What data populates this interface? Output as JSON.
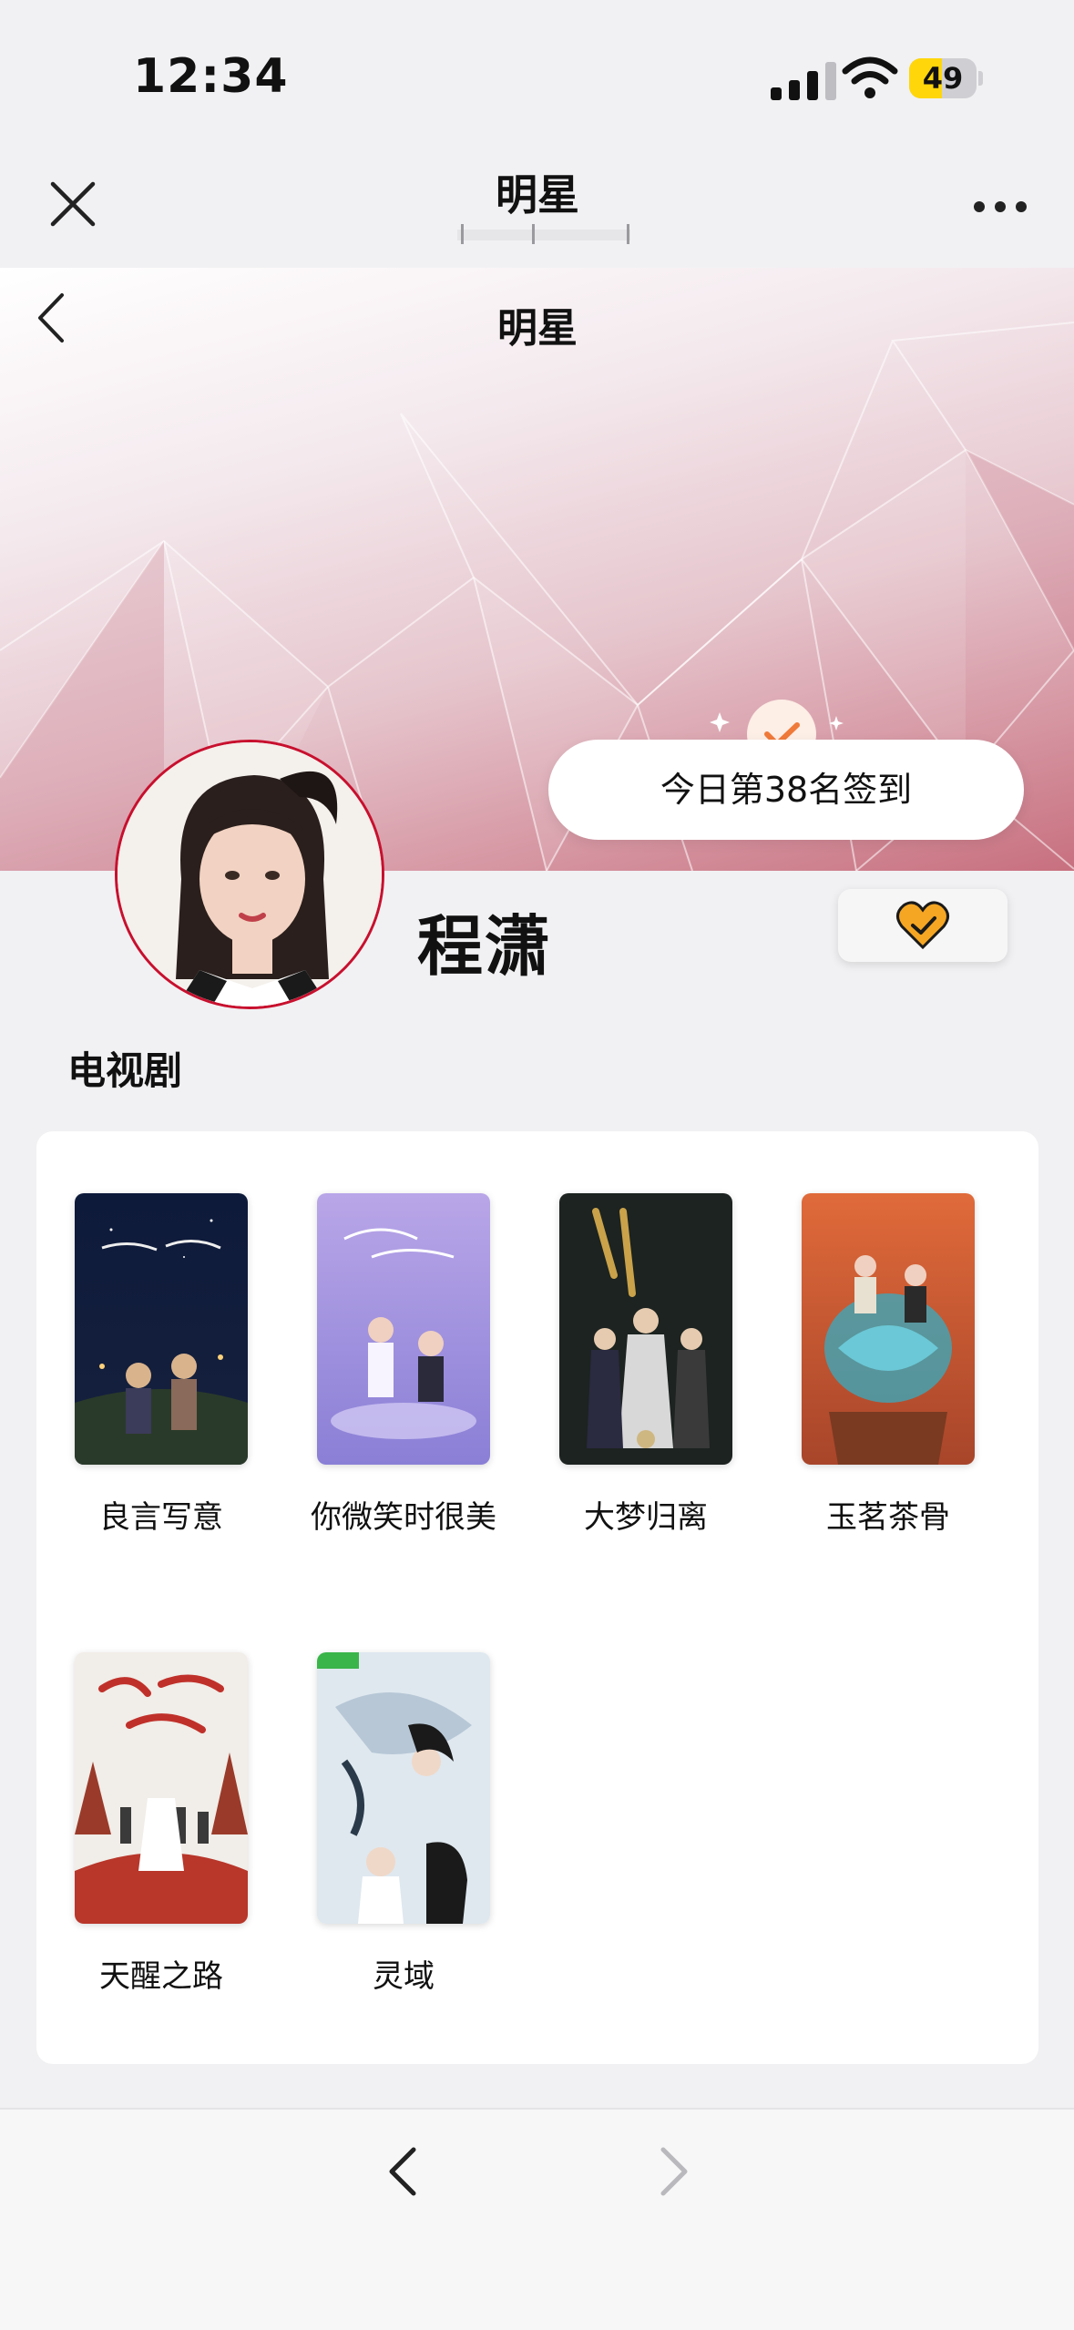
{
  "status_bar": {
    "time": "12:34",
    "battery_level": "49",
    "battery_fraction": 0.49
  },
  "nav": {
    "title": "明星"
  },
  "banner": {
    "title": "明星"
  },
  "checkin": {
    "text": "今日第38名签到"
  },
  "profile": {
    "name": "程潇"
  },
  "section": {
    "title": "电视剧"
  },
  "dramas": [
    {
      "title": "良言写意"
    },
    {
      "title": "你微笑时很美"
    },
    {
      "title": "大梦归离"
    },
    {
      "title": "玉茗茶骨"
    },
    {
      "title": "天醒之路"
    },
    {
      "title": "灵域"
    }
  ],
  "colors": {
    "accent": "#c8102e",
    "follow_heart": "#f5a623",
    "check": "#f07a3a"
  }
}
